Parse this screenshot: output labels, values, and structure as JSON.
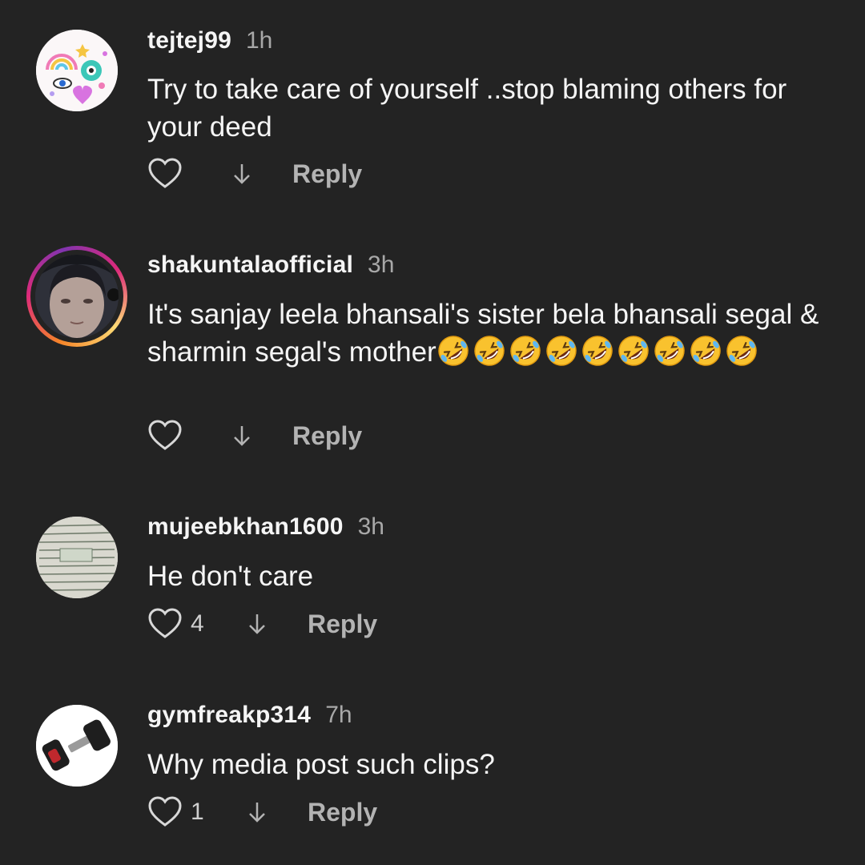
{
  "comments": [
    {
      "username": "tejtej99",
      "time": "1h",
      "text": "Try to take care of yourself ..stop blaming others for your deed",
      "likes": "",
      "reply_label": "Reply",
      "avatar": "colorful-doodle-avatar"
    },
    {
      "username": "shakuntalaofficial",
      "time": "3h",
      "text": "It's sanjay leela bhansali's sister bela bhansali segal & sharmin segal's mother",
      "emoji_count": 9,
      "emoji": "rolling-on-floor-laughing",
      "likes": "",
      "reply_label": "Reply",
      "avatar": "photo-avatar-with-story-ring"
    },
    {
      "username": "mujeebkhan1600",
      "time": "3h",
      "text": "He don't care",
      "likes": "4",
      "reply_label": "Reply",
      "avatar": "handwritten-page-avatar"
    },
    {
      "username": "gymfreakp314",
      "time": "7h",
      "text": "Why media post such clips?",
      "likes": "1",
      "reply_label": "Reply",
      "avatar": "dumbbell-avatar"
    }
  ],
  "colors": {
    "background": "#232323",
    "username": "#f5f5f5",
    "timestamp": "#a8a8a8",
    "reply": "#b3b3b3"
  }
}
